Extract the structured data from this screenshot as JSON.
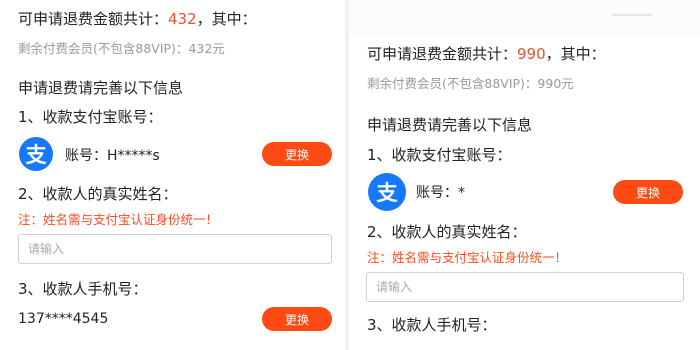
{
  "left": {
    "total_label": "可申请退费金额共计：",
    "total_amount": "432",
    "total_suffix": "，其中：",
    "remaining": "剩余付费会员(不包含88VIP)：432元",
    "info_heading": "申请退费请完善以下信息",
    "section1": "1、收款支付宝账号：",
    "account": "账号：H*****s",
    "change_label": "更换",
    "section2": "2、收款人的真实姓名：",
    "name_note": "注：姓名需与支付宝认证身份统一！",
    "name_placeholder": "请输入",
    "section3": "3、收款人手机号：",
    "phone": "137****4545",
    "phone_change_label": "更换"
  },
  "right": {
    "total_label": "可申请退费金额共计：",
    "total_amount": "990",
    "total_suffix": "，其中：",
    "remaining": "剩余付费会员(不包含88VIP)：990元",
    "info_heading": "申请退费请完善以下信息",
    "section1": "1、收款支付宝账号：",
    "account": "账号：*",
    "change_label": "更换",
    "section2": "2、收款人的真实姓名：",
    "name_note": "注：姓名需与支付宝认证身份统一！",
    "name_placeholder": "请输入",
    "section3": "3、收款人手机号："
  },
  "alipay_icon_glyph": "支",
  "colors": {
    "accent_orange": "#ff4a14",
    "amount_red": "#e8512d",
    "alipay_blue": "#1677ff",
    "muted_gray": "#9a9a9a"
  }
}
